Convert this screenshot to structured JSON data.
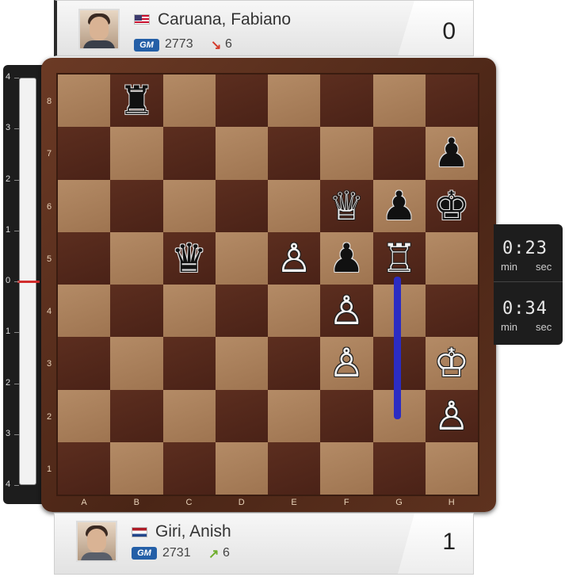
{
  "top_player": {
    "name": "Caruana, Fabiano",
    "title": "GM",
    "rating": "2773",
    "rating_change": "6",
    "rating_trend": "down",
    "flag": "USA",
    "score": "0"
  },
  "bottom_player": {
    "name": "Giri, Anish",
    "title": "GM",
    "rating": "2731",
    "rating_change": "6",
    "rating_trend": "up",
    "flag": "Netherlands",
    "score": "1"
  },
  "eval_bar": {
    "ticks": [
      "4",
      "3",
      "2",
      "1",
      "0",
      "1",
      "2",
      "3",
      "4"
    ],
    "value": 0
  },
  "clocks": {
    "top": {
      "time": "0:23",
      "min_label": "min",
      "sec_label": "sec"
    },
    "bottom": {
      "time": "0:34",
      "min_label": "min",
      "sec_label": "sec"
    }
  },
  "board": {
    "ranks": [
      "8",
      "7",
      "6",
      "5",
      "4",
      "3",
      "2",
      "1"
    ],
    "files": [
      "A",
      "B",
      "C",
      "D",
      "E",
      "F",
      "G",
      "H"
    ],
    "pieces": [
      {
        "square": "b8",
        "type": "rook",
        "color": "black"
      },
      {
        "square": "h7",
        "type": "pawn",
        "color": "black"
      },
      {
        "square": "f6",
        "type": "queen",
        "color": "white"
      },
      {
        "square": "g6",
        "type": "pawn",
        "color": "black"
      },
      {
        "square": "h6",
        "type": "king",
        "color": "black"
      },
      {
        "square": "c5",
        "type": "queen",
        "color": "black"
      },
      {
        "square": "e5",
        "type": "pawn",
        "color": "white"
      },
      {
        "square": "f5",
        "type": "pawn",
        "color": "black"
      },
      {
        "square": "g5",
        "type": "rook",
        "color": "white"
      },
      {
        "square": "f4",
        "type": "pawn",
        "color": "white"
      },
      {
        "square": "f3",
        "type": "pawn",
        "color": "white"
      },
      {
        "square": "h3",
        "type": "king",
        "color": "white"
      },
      {
        "square": "h2",
        "type": "pawn",
        "color": "white"
      }
    ],
    "last_move": {
      "from": "g2",
      "to": "g5"
    },
    "arrow_color": "#2b2cc3"
  },
  "colors": {
    "light_square": "#a87e59",
    "dark_square": "#532719",
    "flip_down": "#d43a2a",
    "flip_up": "#6fae2d",
    "eval_marker": "#d12d2d"
  }
}
